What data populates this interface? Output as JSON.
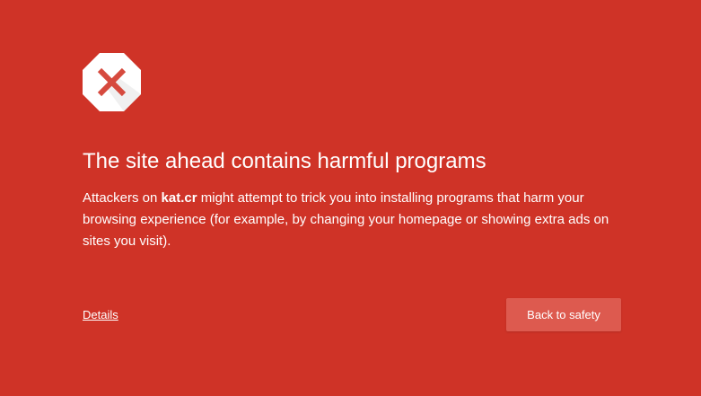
{
  "interstitial": {
    "icon": "error-octagon-x-icon",
    "headline": "The site ahead contains harmful programs",
    "body_prefix": "Attackers on ",
    "site_name": "kat.cr",
    "body_suffix": " might attempt to trick you into installing programs that harm your browsing experience (for example, by changing your homepage or showing extra ads on sites you visit).",
    "details_label": "Details",
    "back_label": "Back to safety"
  },
  "colors": {
    "background": "#cf3327",
    "button": "#dd5a4f",
    "icon_x": "#d64a3e",
    "text": "#ffffff"
  }
}
